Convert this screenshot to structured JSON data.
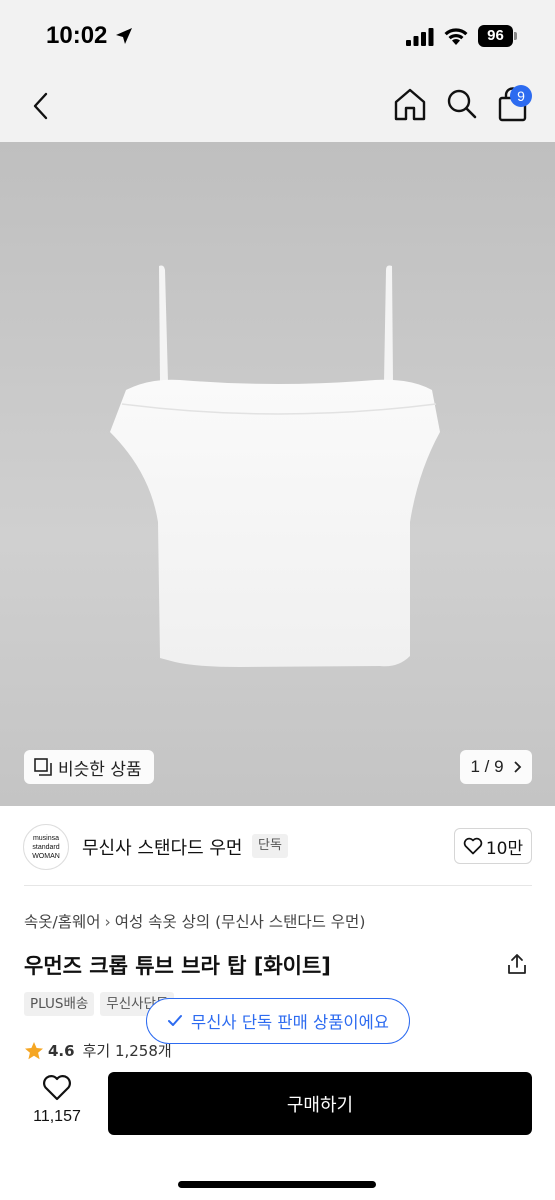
{
  "status_bar": {
    "time": "10:02",
    "battery": "96"
  },
  "nav": {
    "cart_count": "9"
  },
  "gallery": {
    "similar_label": "비슷한 상품",
    "page_indicator": "1 / 9"
  },
  "brand": {
    "logo_lines": [
      "musinsa",
      "standard",
      "WOMAN"
    ],
    "name": "무신사 스탠다드 우먼",
    "tag": "단독",
    "like_count": "10만"
  },
  "product": {
    "breadcrumb": [
      "속옷/홈웨어",
      "여성 속옷 상의 (무신사 스탠다드 우먼)"
    ],
    "title": "우먼즈 크롭 튜브 브라 탑 [화이트]",
    "tags": [
      "PLUS배송",
      "무신사단독"
    ],
    "rating": "4.6",
    "reviews": "후기 1,258개"
  },
  "toast": {
    "text": "무신사 단독 판매 상품이에요"
  },
  "bottom_bar": {
    "wish_count": "11,157",
    "buy_label": "구매하기"
  },
  "colors": {
    "accent": "#2d6bf0",
    "buy_button": "#000000",
    "star": "#f5a623"
  },
  "icons": [
    "location-arrow-icon",
    "signal-icon",
    "wifi-icon",
    "back-icon",
    "home-icon",
    "search-icon",
    "shopping-bag-icon",
    "similar-icon",
    "chevron-right-icon",
    "heart-icon",
    "share-icon",
    "star-icon",
    "check-icon"
  ]
}
